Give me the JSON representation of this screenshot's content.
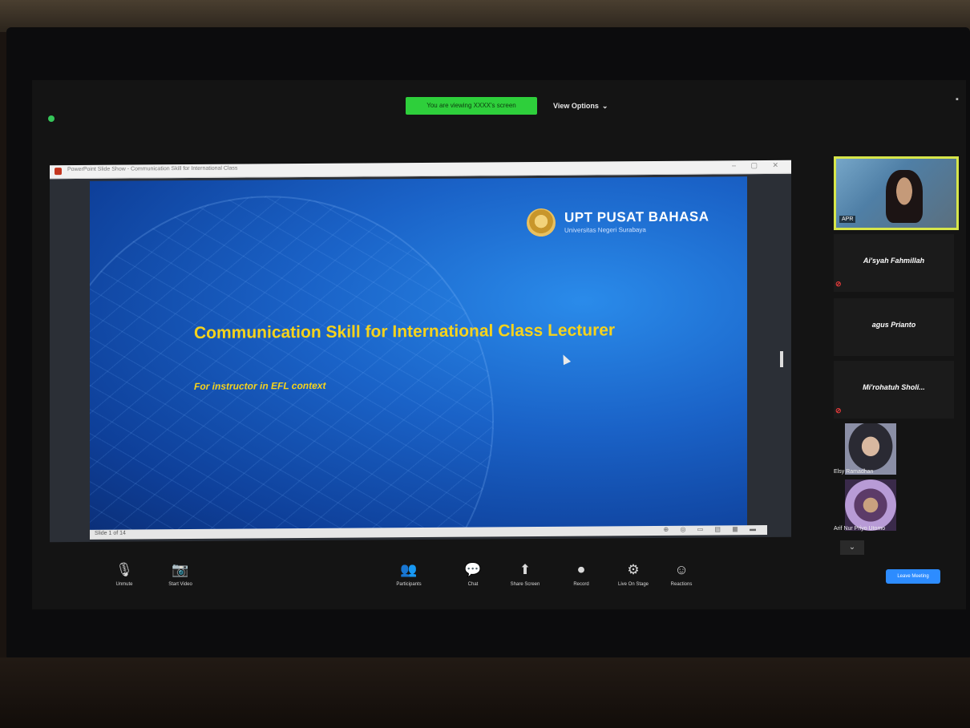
{
  "meeting": {
    "viewing_banner": "You are viewing XXXX's screen",
    "view_options": "View Options",
    "view_options_caret": "⌄"
  },
  "share_window": {
    "title": "PowerPoint Slide Show - Communication Skill for International Class",
    "statusbar": "Slide 1 of 14",
    "tools": "⊕ ◎ ▭ ▤ ▦ ▬"
  },
  "slide": {
    "org_name": "UPT PUSAT BAHASA",
    "org_sub": "Universitas Negeri Surabaya",
    "title": "Communication Skill for International Class Lecturer",
    "subtitle": "For instructor in EFL context"
  },
  "participants": {
    "main_video_tag": "APR",
    "tiles": [
      {
        "name": "Ai'syah Fahmillah",
        "muted": true
      },
      {
        "name": "agus Prianto",
        "muted": false
      },
      {
        "name": "Mi'rohatuh Sholi...",
        "muted": true
      }
    ],
    "thumbs": [
      {
        "name": "Elsy Ramadhan"
      },
      {
        "name": "Arif Nur Priyo Utomo"
      }
    ],
    "scroll_down": "⌄"
  },
  "toolbar": {
    "items": [
      {
        "icon": "🎙",
        "label": "Unmute"
      },
      {
        "icon": "📷",
        "label": "Start Video"
      },
      {
        "icon": "👥",
        "label": "Participants"
      },
      {
        "icon": "💬",
        "label": "Chat"
      },
      {
        "icon": "⬆",
        "label": "Share Screen"
      },
      {
        "icon": "⏺",
        "label": "Record"
      },
      {
        "icon": "⚙",
        "label": "Live On Stage"
      },
      {
        "icon": "☺",
        "label": "Reactions"
      }
    ],
    "end_button": "Leave Meeting"
  },
  "colors": {
    "banner": "#2ecf3b",
    "slide_title": "#f6d31c",
    "speaker_border": "#d7e64a",
    "accent": "#2d8cff"
  }
}
